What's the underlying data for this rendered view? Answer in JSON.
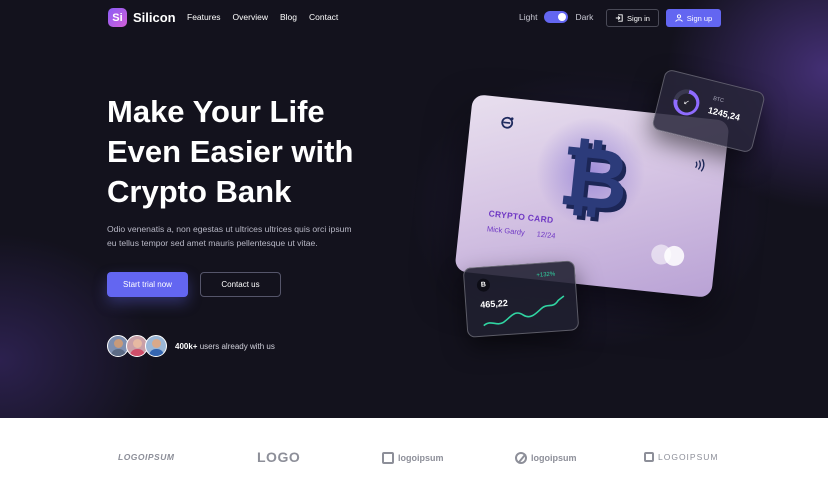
{
  "brand": {
    "mark": "Si",
    "name": "Silicon"
  },
  "nav": {
    "items": [
      "Features",
      "Overview",
      "Blog",
      "Contact"
    ]
  },
  "theme_toggle": {
    "light_label": "Light",
    "dark_label": "Dark",
    "state": "dark"
  },
  "header_buttons": {
    "signin_label": "Sign in",
    "signup_label": "Sign up"
  },
  "hero": {
    "headline": [
      "Make Your Life",
      "Even Easier with",
      "Crypto Bank"
    ],
    "description": "Odio venenatis a, non egestas ut ultrices ultrices quis orci ipsum eu tellus tempor sed amet mauris pellentesque ut vitae.",
    "primary_cta": "Start trial now",
    "secondary_cta": "Contact us",
    "users_count": "400k+",
    "users_text": " users already with us"
  },
  "card": {
    "title": "CRYPTO CARD",
    "holder": "Mick Gardy",
    "expiry": "12/24",
    "symbol": "₿"
  },
  "widget_top": {
    "symbol": "BTC",
    "value": "1245,24"
  },
  "widget_bottom": {
    "coin": "B",
    "change": "+132%",
    "value": "465,22"
  },
  "logos": [
    "LOGOIPSUM",
    "LOGO",
    "logoipsum",
    "logoipsum",
    "LOGOIPSUM"
  ],
  "colors": {
    "accent": "#6366f1",
    "hero_bg": "#13121d",
    "positive": "#30d5a2"
  },
  "icons": {
    "signin": "login-icon",
    "signup": "user-icon",
    "nfc": "contactless-icon"
  }
}
